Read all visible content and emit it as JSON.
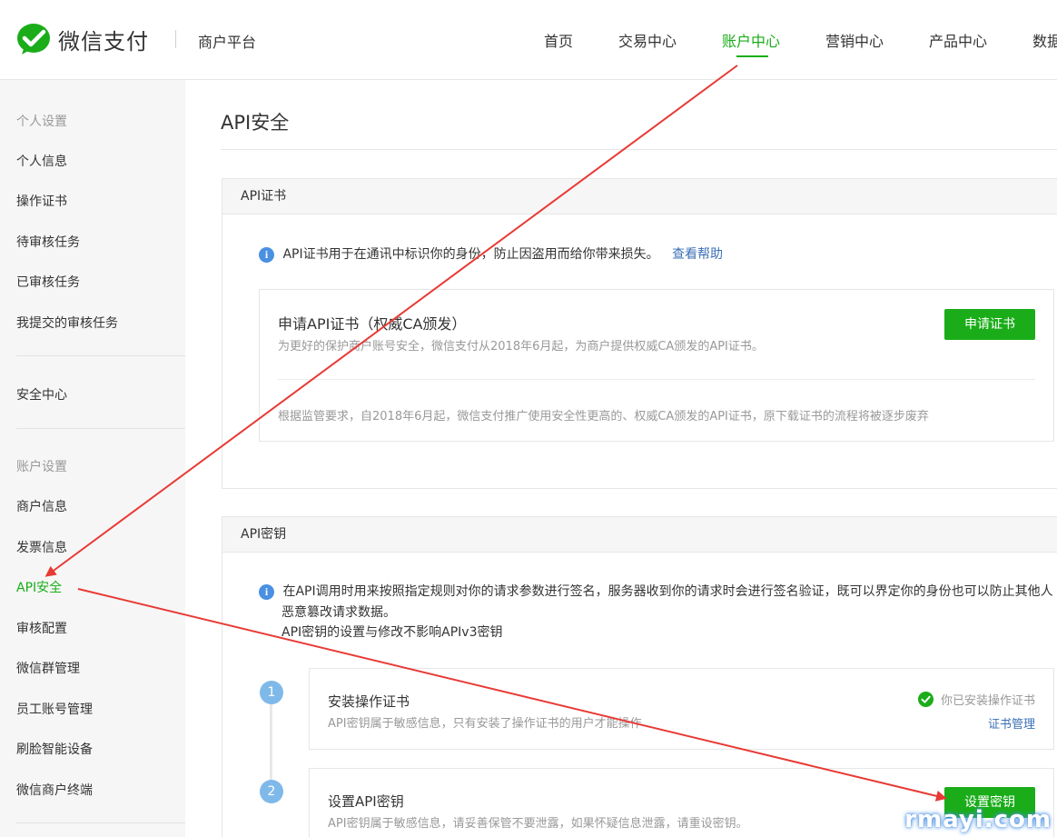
{
  "header": {
    "brand": "微信支付",
    "platform": "商户平台",
    "nav": [
      {
        "label": "首页",
        "active": false
      },
      {
        "label": "交易中心",
        "active": false
      },
      {
        "label": "账户中心",
        "active": true
      },
      {
        "label": "营销中心",
        "active": false
      },
      {
        "label": "产品中心",
        "active": false
      },
      {
        "label": "数据",
        "active": false
      }
    ]
  },
  "sidebar": {
    "group1": "个人设置",
    "items1": [
      "个人信息",
      "操作证书",
      "待审核任务",
      "已审核任务",
      "我提交的审核任务"
    ],
    "security": "安全中心",
    "group2": "账户设置",
    "items2": [
      "商户信息",
      "发票信息",
      "API安全",
      "审核配置",
      "微信群管理",
      "员工账号管理",
      "刷脸智能设备",
      "微信商户终端"
    ],
    "active": "API安全"
  },
  "main": {
    "title": "API安全",
    "cert_panel": {
      "heading": "API证书",
      "info": "API证书用于在通讯中标识你的身份，防止因盗用而给你带来损失。",
      "help_link": "查看帮助",
      "card": {
        "title": "申请API证书（权威CA颁发）",
        "desc": "为更好的保护商户账号安全，微信支付从2018年6月起，为商户提供权威CA颁发的API证书。",
        "button": "申请证书",
        "note": "根据监管要求，自2018年6月起，微信支付推广使用安全性更高的、权威CA颁发的API证书，原下载证书的流程将被逐步废弃"
      }
    },
    "key_panel": {
      "heading": "API密钥",
      "info_line1": "在API调用时用来按照指定规则对你的请求参数进行签名，服务器收到你的请求时会进行签名验证，既可以界定你的身份也可以防止其他人",
      "info_line2": "恶意篡改请求数据。",
      "info_line3": "API密钥的设置与修改不影响APIv3密钥",
      "steps": [
        {
          "number": "1",
          "title": "安装操作证书",
          "desc": "API密钥属于敏感信息，只有安装了操作证书的用户才能操作",
          "status": "你已安装操作证书",
          "link": "证书管理"
        },
        {
          "number": "2",
          "title": "设置API密钥",
          "desc": "API密钥属于敏感信息，请妥善保管不要泄露，如果怀疑信息泄露，请重设密钥。",
          "button": "设置密钥"
        }
      ]
    }
  },
  "watermark": "rmayi.com",
  "colors": {
    "accent": "#1aad19",
    "link": "#3b6fb6",
    "info": "#4a90e2",
    "annotation": "#e83a35"
  }
}
